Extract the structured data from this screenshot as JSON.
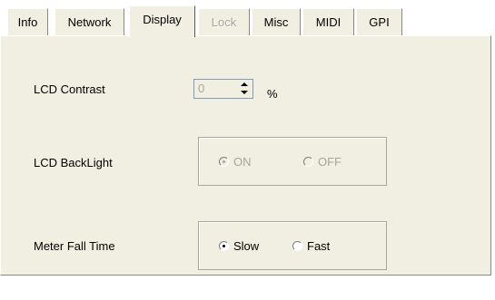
{
  "tabs": [
    {
      "label": "Info",
      "state": "normal"
    },
    {
      "label": "Network",
      "state": "normal"
    },
    {
      "label": "Display",
      "state": "active"
    },
    {
      "label": "Lock",
      "state": "disabled"
    },
    {
      "label": "Misc",
      "state": "normal"
    },
    {
      "label": "MIDI",
      "state": "normal"
    },
    {
      "label": "GPI",
      "state": "normal"
    }
  ],
  "lcd_contrast": {
    "label": "LCD Contrast",
    "value": "0",
    "unit": "%",
    "enabled": false
  },
  "lcd_backlight": {
    "label": "LCD BackLight",
    "enabled": false,
    "options": [
      {
        "label": "ON",
        "checked": true
      },
      {
        "label": "OFF",
        "checked": false
      }
    ]
  },
  "meter_fall_time": {
    "label": "Meter Fall Time",
    "enabled": true,
    "options": [
      {
        "label": "Slow",
        "checked": true
      },
      {
        "label": "Fast",
        "checked": false
      }
    ]
  },
  "colors": {
    "face": "#f1efe2",
    "disabled_text": "#a7a59a"
  }
}
